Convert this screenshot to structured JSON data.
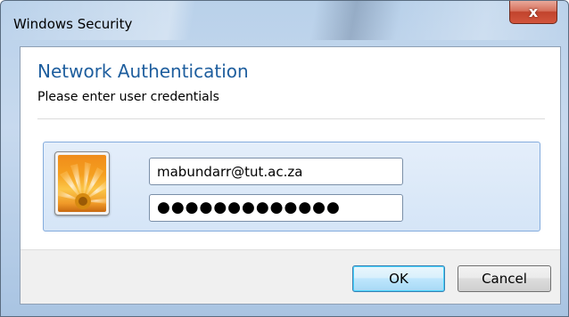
{
  "window": {
    "title": "Windows Security",
    "close_glyph": "x"
  },
  "dialog": {
    "heading": "Network Authentication",
    "subheading": "Please enter user credentials"
  },
  "credentials": {
    "avatar_icon": "user-tile-flower-icon",
    "username_value": "mabundarr@tut.ac.za",
    "password_mask": "●●●●●●●●●●●●●"
  },
  "buttons": {
    "ok_label": "OK",
    "cancel_label": "Cancel"
  },
  "colors": {
    "heading": "#1e5e9e",
    "close_button": "#c1432c",
    "tile_border": "#84acdd"
  }
}
